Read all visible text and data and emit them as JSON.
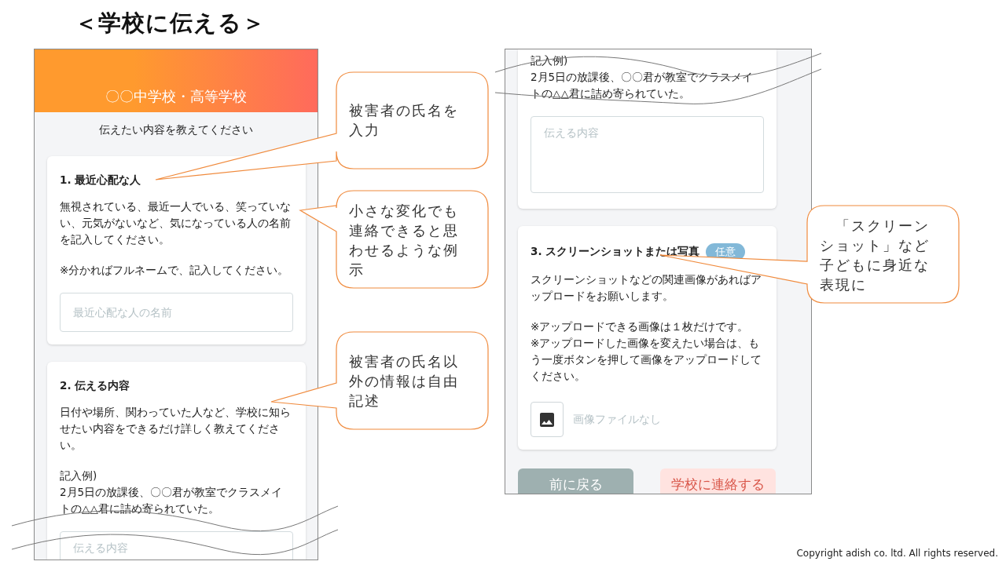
{
  "slide_title": "＜学校に伝える＞",
  "left_screen": {
    "header_title": "〇〇中学校・高等学校",
    "subtitle": "伝えたい内容を教えてください",
    "cards": [
      {
        "kind": "name",
        "heading": "1. 最近心配な人",
        "paragraphs": [
          "無視されている、最近一人でいる、笑っていない、元気がないなど、気になっている人の名前を記入してください。",
          "※分かればフルネームで、記入してください。"
        ],
        "placeholder": "最近心配な人の名前"
      },
      {
        "kind": "content",
        "heading": "2. 伝える内容",
        "paragraphs": [
          "日付や場所、関わっていた人など、学校に知らせたい内容をできるだけ詳しく教えてください。"
        ],
        "example_label": "記入例)",
        "example_text": "2月5日の放課後、〇〇君が教室でクラスメイトの△△君に詰め寄られていた。",
        "placeholder": "伝える内容"
      }
    ]
  },
  "right_screen": {
    "continued_card": {
      "example_label": "記入例)",
      "example_text": "2月5日の放課後、〇〇君が教室でクラスメイトの△△君に詰め寄られていた。",
      "placeholder": "伝える内容"
    },
    "upload_card": {
      "heading": "3. スクリーンショットまたは写真",
      "badge": "任意",
      "description": "スクリーンショットなどの関連画像があればアップロードをお願いします。",
      "notes": [
        "※アップロードできる画像は１枚だけです。",
        "※アップロードした画像を変えたい場合は、もう一度ボタンを押して画像をアップロードしてください。"
      ],
      "file_status": "画像ファイルなし"
    },
    "buttons": [
      {
        "kind": "back",
        "label": "前に戻る",
        "disabled": false
      },
      {
        "kind": "submit",
        "label": "学校に連絡する",
        "disabled": true
      }
    ]
  },
  "callouts": [
    {
      "text": "被害者の氏名を入力"
    },
    {
      "text": "小さな変化でも連絡できると思わせるような例示"
    },
    {
      "text": "被害者の氏名以外の情報は自由記述"
    },
    {
      "text": "「スクリーンショット」など子どもに身近な表現に"
    }
  ],
  "copyright": "Copyright adish co. ltd. All rights reserved."
}
